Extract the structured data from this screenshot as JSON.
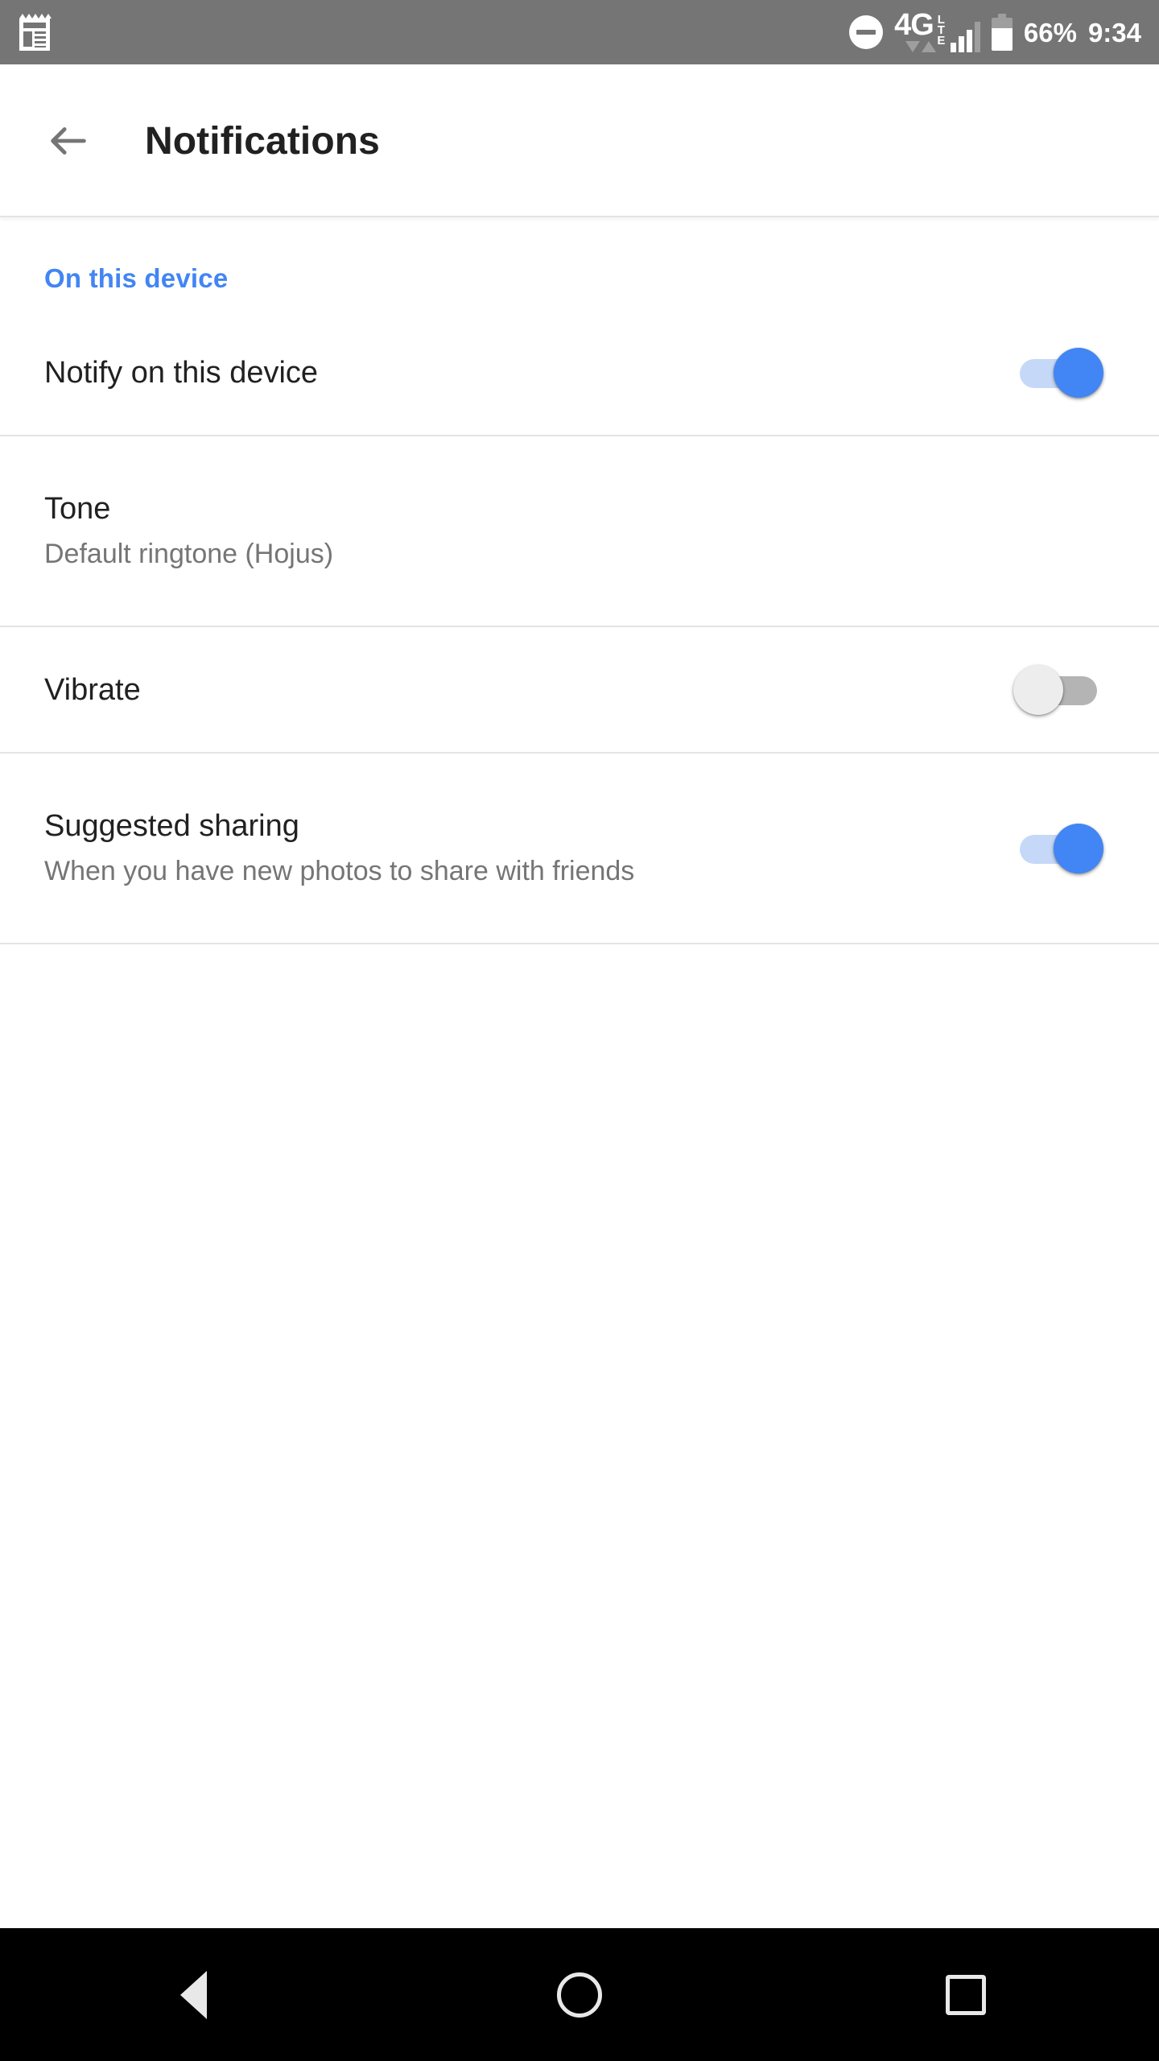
{
  "status_bar": {
    "left_icons": [
      {
        "name": "receipt-notification-icon",
        "glyph": "receipt"
      }
    ],
    "dnd_icon": "do-not-disturb-icon",
    "network_label": "4G",
    "network_sublabel": "LTE",
    "data_arrows": "down-up-arrows-icon",
    "signal_icon": "signal-bars-icon",
    "battery_icon": "battery-icon",
    "battery_percent": "66%",
    "clock": "9:34",
    "background_color": "#757575"
  },
  "app_bar": {
    "back_icon": "back-arrow-icon",
    "title": "Notifications"
  },
  "settings": {
    "sections": [
      {
        "header": "On this device",
        "header_color": "#4285f4",
        "rows": [
          {
            "title": "Notify on this device",
            "subtitle": "",
            "control": "switch",
            "state": "on"
          },
          {
            "title": "Tone",
            "subtitle": "Default ringtone (Hojus)",
            "control": "none",
            "state": ""
          },
          {
            "title": "Vibrate",
            "subtitle": "",
            "control": "switch",
            "state": "off"
          },
          {
            "title": "Suggested sharing",
            "subtitle": "When you have new photos to share with friends",
            "control": "switch",
            "state": "on"
          }
        ]
      }
    ]
  },
  "nav_bar": {
    "back": "nav-back-icon",
    "home": "nav-home-icon",
    "recents": "nav-recents-icon",
    "background_color": "#000000"
  },
  "theme": {
    "accent": "#4285f4",
    "switch_on_track": "#c6d8f8",
    "switch_off_track": "#b4b4b4",
    "divider": "#e4e4e4",
    "primary_text": "#212121",
    "secondary_text": "#757575"
  }
}
